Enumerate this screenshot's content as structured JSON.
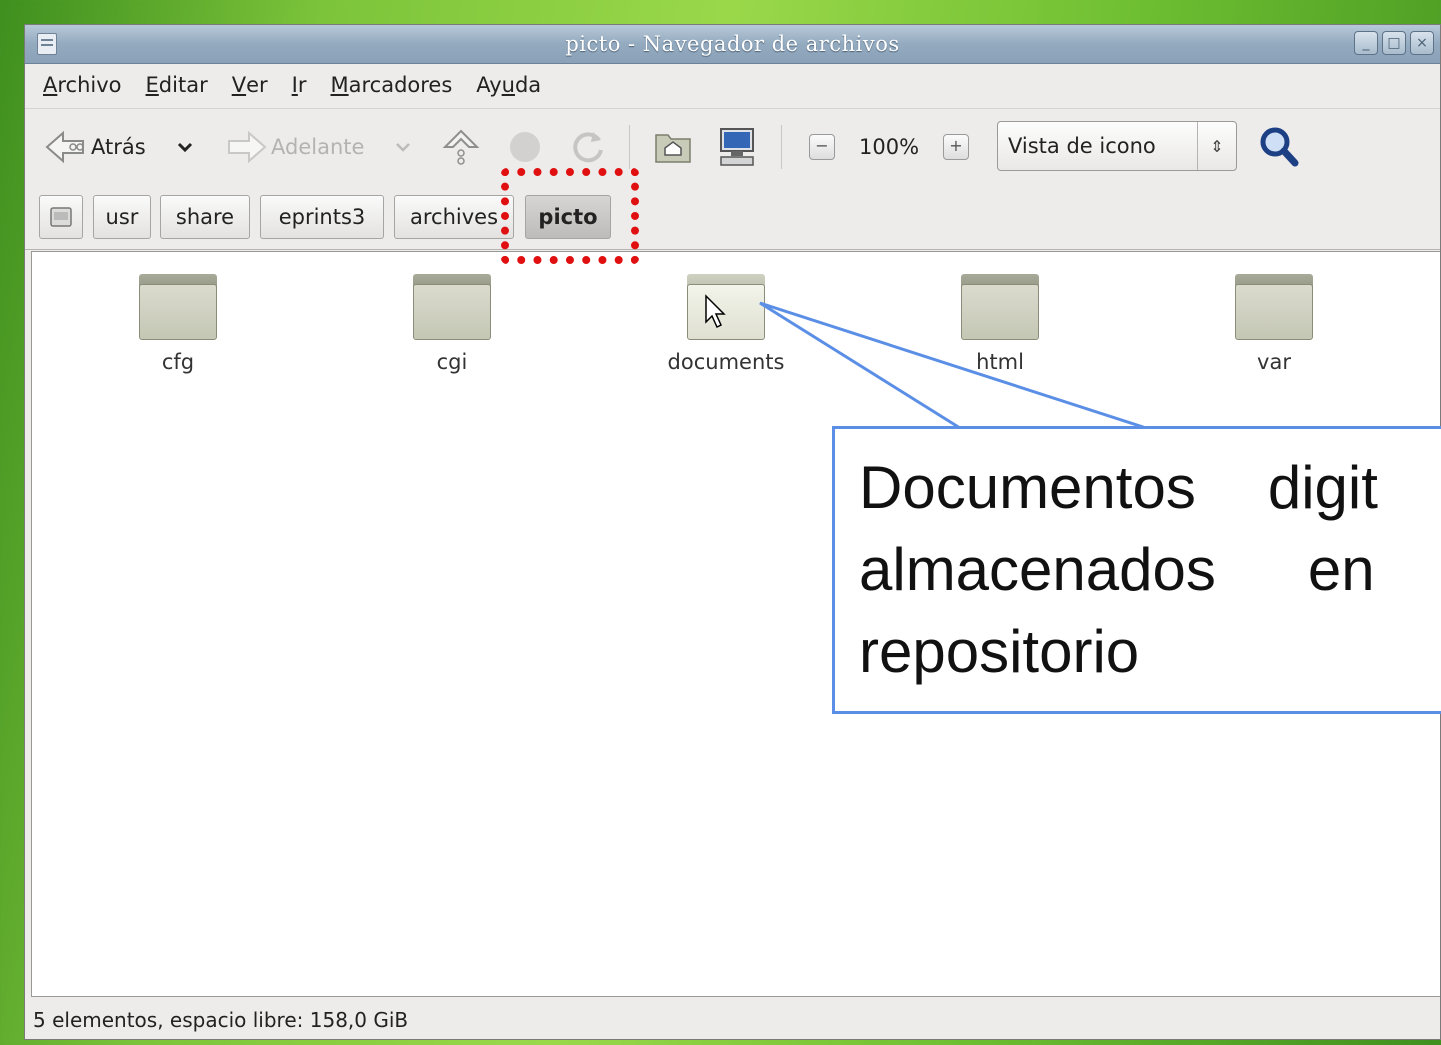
{
  "window": {
    "title": "picto - Navegador de archivos",
    "controls": [
      "_",
      "□",
      "×"
    ]
  },
  "menu": {
    "items": [
      {
        "before": "",
        "mnemonic": "A",
        "after": "rchivo"
      },
      {
        "before": "",
        "mnemonic": "E",
        "after": "ditar"
      },
      {
        "before": "",
        "mnemonic": "V",
        "after": "er"
      },
      {
        "before": "",
        "mnemonic": "I",
        "after": "r"
      },
      {
        "before": "",
        "mnemonic": "M",
        "after": "arcadores"
      },
      {
        "before": "Ay",
        "mnemonic": "u",
        "after": "da"
      }
    ]
  },
  "toolbar": {
    "back_label": "Atrás",
    "forward_label": "Adelante",
    "zoom_level": "100%",
    "zoom_out_symbol": "−",
    "zoom_in_symbol": "+",
    "view_mode": "Vista de icono",
    "icons": [
      "back-icon",
      "dropdown-icon",
      "forward-icon",
      "up-icon",
      "stop-icon",
      "reload-icon",
      "home-icon",
      "computer-icon",
      "zoom-out-icon",
      "zoom-in-icon",
      "search-icon"
    ]
  },
  "pathbar": {
    "crumbs": [
      "usr",
      "share",
      "eprints3",
      "archives",
      "picto"
    ],
    "active": "picto"
  },
  "folders": [
    {
      "name": "cfg"
    },
    {
      "name": "cgi"
    },
    {
      "name": "documents"
    },
    {
      "name": "html"
    },
    {
      "name": "var"
    }
  ],
  "status": "5 elementos, espacio libre: 158,0 GiB",
  "callout": {
    "lines": [
      [
        "Documentos",
        "digit"
      ],
      [
        "almacenados",
        "en"
      ],
      [
        "repositorio"
      ]
    ],
    "border_color": "#5b8fe6"
  },
  "highlight_color": "#e01010"
}
